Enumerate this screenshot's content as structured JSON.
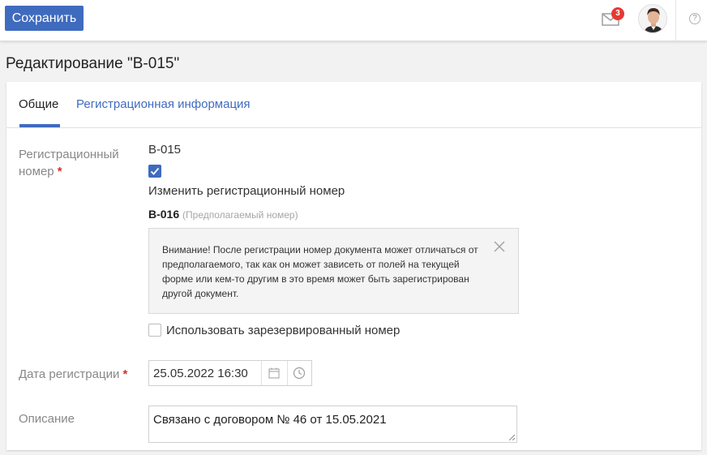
{
  "toolbar": {
    "save_label": "Сохранить",
    "mail_count": "3",
    "help_glyph": "?"
  },
  "page": {
    "title": "Редактирование \"В-015\""
  },
  "tabs": [
    {
      "label": "Общие",
      "active": true
    },
    {
      "label": "Регистрационная информация",
      "active": false
    }
  ],
  "form": {
    "regnum_label": "Регистрационный номер",
    "required_mark": "*",
    "regnum_value": "В-015",
    "change_regnum_label": "Изменить регистрационный номер",
    "change_regnum_checked": true,
    "proposed_number": "В-016",
    "proposed_hint": "(Предполагаемый номер)",
    "alert_text": "Внимание! После регистрации номер документа может отличаться от предполагаемого, так как он может зависеть от полей на текущей форме или кем-то другим в это время может быть зарегистрирован другой документ.",
    "use_reserved_label": "Использовать зарезервированный номер",
    "use_reserved_checked": false,
    "date_label": "Дата регистрации",
    "date_value": "25.05.2022  16:30",
    "description_label": "Описание",
    "description_value": "Связано с договором № 46 от 15.05.2021"
  },
  "colors": {
    "accent": "#3f6bbf",
    "required": "#d32f2f",
    "badge": "#e53935"
  },
  "icons": [
    "mail-icon",
    "avatar",
    "help-icon",
    "close-icon",
    "calendar-icon",
    "clock-icon",
    "check-icon"
  ]
}
